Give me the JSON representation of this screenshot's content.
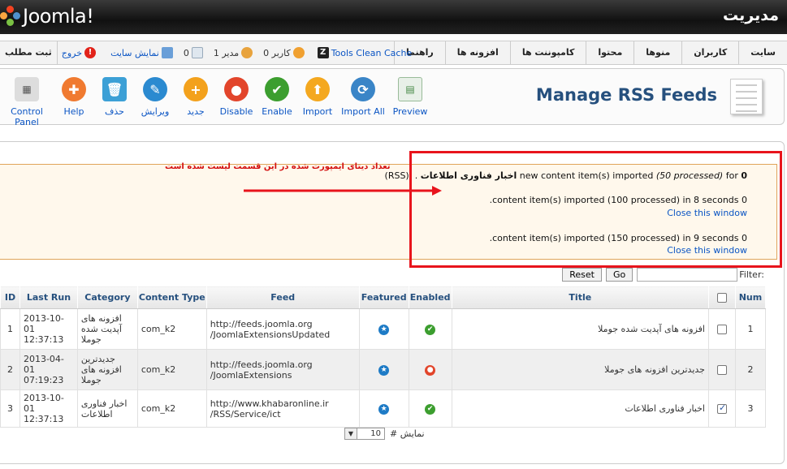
{
  "header": {
    "logo_text": "Joomla!",
    "admin_title": "مدیریت"
  },
  "menu": {
    "items": [
      "سایت",
      "کاربران",
      "منوها",
      "محتوا",
      "کامپوننت ها",
      "افزونه ها",
      "راهنما"
    ],
    "left": {
      "new_post": "ثبت مطلب",
      "logout": "خروج",
      "view_site": "نمایش سایت",
      "messages_count": "0",
      "admin_count": "1 مدیر",
      "users_count": "0 کاربر",
      "tools_clean_cache": "Tools Clean Cache"
    }
  },
  "toolbar": {
    "title": "Manage RSS Feeds",
    "buttons": [
      {
        "label": "Control Panel",
        "icon": "control-panel-icon",
        "color": "#dddddd"
      },
      {
        "label": "Help",
        "icon": "help-icon",
        "color": "#f07a30"
      },
      {
        "label": "حذف",
        "icon": "delete-icon",
        "color": "#3ca0d6"
      },
      {
        "label": "ویرایش",
        "icon": "edit-icon",
        "color": "#2b8ad0"
      },
      {
        "label": "جدید",
        "icon": "new-icon",
        "color": "#f3a11c"
      },
      {
        "label": "Disable",
        "icon": "disable-icon",
        "color": "#e2452b"
      },
      {
        "label": "Enable",
        "icon": "enable-icon",
        "color": "#3c9e2f"
      },
      {
        "label": "Import",
        "icon": "import-icon",
        "color": "#f4a81f"
      },
      {
        "label": "Import All",
        "icon": "import-all-icon",
        "color": "#3a85c7"
      },
      {
        "label": "Preview",
        "icon": "preview-icon",
        "color": "#e8f0e8"
      }
    ]
  },
  "messages": {
    "line1_count": "0",
    "line1_text_for": "for",
    "line1_processed": "(50 processed)",
    "line1_main": "new content item(s) imported",
    "line1_feed": "اخبار فناوری اطلاعات",
    "line1_suffix": "(RSS). .",
    "line2": ".content item(s) imported (100 processed) in 8 seconds 0",
    "line3": ".content item(s) imported (150 processed) in 9 seconds 0",
    "close": "Close this window",
    "annotation": "تعداد دیتای ایمپورت شده در این قسمت لیست شده است"
  },
  "filter": {
    "label": "Filter:",
    "value": "",
    "go": "Go",
    "reset": "Reset"
  },
  "table": {
    "headers": {
      "id": "ID",
      "last_run": "Last Run",
      "category": "Category",
      "content_type": "Content Type",
      "feed": "Feed",
      "featured": "Featured",
      "enabled": "Enabled",
      "title": "Title",
      "num": "Num"
    },
    "rows": [
      {
        "id": "1",
        "last_run_date": "2013-10-01",
        "last_run_time": "12:37:13",
        "category": "افزونه های آپدیت شده جوملا",
        "content_type": "com_k2",
        "feed_line1": "http://feeds.joomla.org",
        "feed_line2": "/JoomlaExtensionsUpdated",
        "featured": "featured-icon",
        "enabled": "enabled-icon",
        "title": "افزونه های آپدیت شده جوملا",
        "checked": false,
        "num": "1"
      },
      {
        "id": "2",
        "last_run_date": "2013-04-01",
        "last_run_time": "07:19:23",
        "category": "جدیدترین افزونه های جوملا",
        "content_type": "com_k2",
        "feed_line1": "http://feeds.joomla.org",
        "feed_line2": "/JoomlaExtensions",
        "featured": "featured-icon",
        "enabled": "disabled-icon",
        "title": "جدیدترین افزونه های جوملا",
        "checked": false,
        "num": "2"
      },
      {
        "id": "3",
        "last_run_date": "2013-10-01",
        "last_run_time": "12:37:13",
        "category": "اخبار فناوری اطلاعات",
        "content_type": "com_k2",
        "feed_line1": "http://www.khabaronline.ir",
        "feed_line2": "/RSS/Service/ict",
        "featured": "featured-icon",
        "enabled": "enabled-icon",
        "title": "اخبار فناوری اطلاعات",
        "checked": true,
        "num": "3"
      }
    ]
  },
  "pagination": {
    "label": "نمایش #",
    "limit": "10"
  },
  "colors": {
    "header_bg": "#1a1a1a",
    "link": "#0b55c4",
    "title_blue": "#26507e",
    "annotation_red": "#e8141c",
    "message_bg": "#fff8ec"
  }
}
